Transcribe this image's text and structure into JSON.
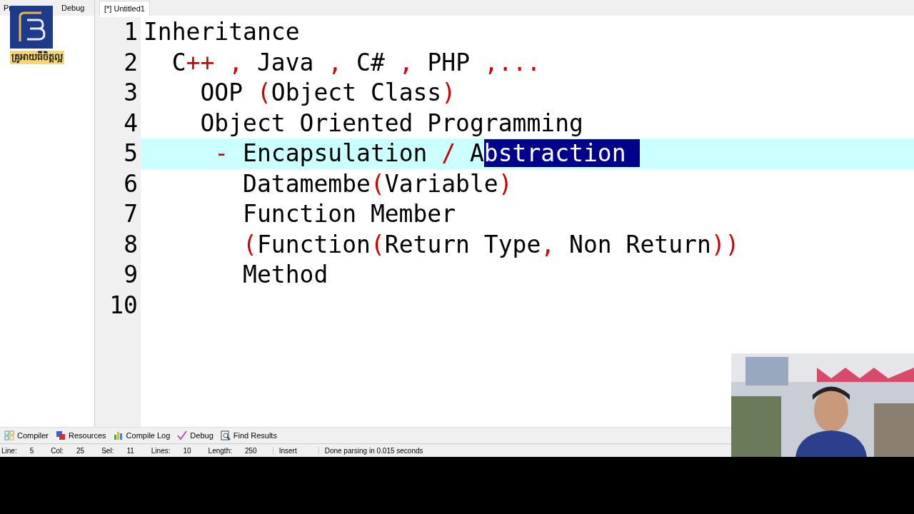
{
  "side_panel": {
    "tabs": [
      {
        "label": "Pr",
        "selected": false
      },
      {
        "label": "Debug",
        "selected": false
      }
    ]
  },
  "logo": {
    "caption": "គ្រូអាយធីចិត្តល្អ"
  },
  "editor": {
    "tab": {
      "label": "[*] Untitled1",
      "selected": true
    },
    "lines": [
      {
        "number": "1",
        "current": false,
        "tokens": [
          {
            "text": "Inheritance",
            "kind": "plain"
          }
        ]
      },
      {
        "number": "2",
        "current": false,
        "tokens": [
          {
            "text": "  C",
            "kind": "plain"
          },
          {
            "text": "++ , ",
            "kind": "symbol"
          },
          {
            "text": "Java ",
            "kind": "plain"
          },
          {
            "text": ", ",
            "kind": "symbol"
          },
          {
            "text": "C# ",
            "kind": "plain"
          },
          {
            "text": ", ",
            "kind": "symbol"
          },
          {
            "text": "PHP ",
            "kind": "plain"
          },
          {
            "text": ",...",
            "kind": "symbol"
          }
        ]
      },
      {
        "number": "3",
        "current": false,
        "tokens": [
          {
            "text": "    OOP ",
            "kind": "plain"
          },
          {
            "text": "(",
            "kind": "symbol"
          },
          {
            "text": "Object Class",
            "kind": "plain"
          },
          {
            "text": ")",
            "kind": "symbol"
          }
        ]
      },
      {
        "number": "4",
        "current": false,
        "tokens": [
          {
            "text": "    Object Oriented Programming",
            "kind": "plain"
          }
        ]
      },
      {
        "number": "5",
        "current": true,
        "tokens": [
          {
            "text": "     -",
            "kind": "symbol"
          },
          {
            "text": " Encapsulation ",
            "kind": "plain"
          },
          {
            "text": "/",
            "kind": "symbol"
          },
          {
            "text": " A",
            "kind": "plain"
          },
          {
            "text": "bstraction ",
            "kind": "selected"
          }
        ]
      },
      {
        "number": "6",
        "current": false,
        "tokens": [
          {
            "text": "       Datamembe",
            "kind": "plain"
          },
          {
            "text": "(",
            "kind": "symbol"
          },
          {
            "text": "Variable",
            "kind": "plain"
          },
          {
            "text": ")",
            "kind": "symbol"
          }
        ]
      },
      {
        "number": "7",
        "current": false,
        "tokens": [
          {
            "text": "       Function Member",
            "kind": "plain"
          }
        ]
      },
      {
        "number": "8",
        "current": false,
        "tokens": [
          {
            "text": "       (",
            "kind": "symbol"
          },
          {
            "text": "Function",
            "kind": "plain"
          },
          {
            "text": "(",
            "kind": "symbol"
          },
          {
            "text": "Return Type",
            "kind": "plain"
          },
          {
            "text": ",",
            "kind": "symbol"
          },
          {
            "text": " Non Return",
            "kind": "plain"
          },
          {
            "text": "))",
            "kind": "symbol"
          }
        ]
      },
      {
        "number": "9",
        "current": false,
        "tokens": [
          {
            "text": "       Method",
            "kind": "plain"
          }
        ]
      },
      {
        "number": "10",
        "current": false
      }
    ]
  },
  "bottom_tabs": [
    {
      "label": "Compiler",
      "kind": "grid"
    },
    {
      "label": "Resources",
      "kind": "stack"
    },
    {
      "label": "Compile Log",
      "kind": "bars"
    },
    {
      "label": "Debug",
      "kind": "check"
    },
    {
      "label": "Find Results",
      "kind": "find"
    }
  ],
  "status_bar": {
    "fields": [
      {
        "label": "Line:",
        "value": "5"
      },
      {
        "label": "Col:",
        "value": "25"
      },
      {
        "label": "Sel:",
        "value": "11"
      },
      {
        "label": "Lines:",
        "value": "10"
      },
      {
        "label": "Length:",
        "value": "250"
      }
    ],
    "mode": "Insert",
    "message": "Done parsing in 0.015 seconds"
  }
}
